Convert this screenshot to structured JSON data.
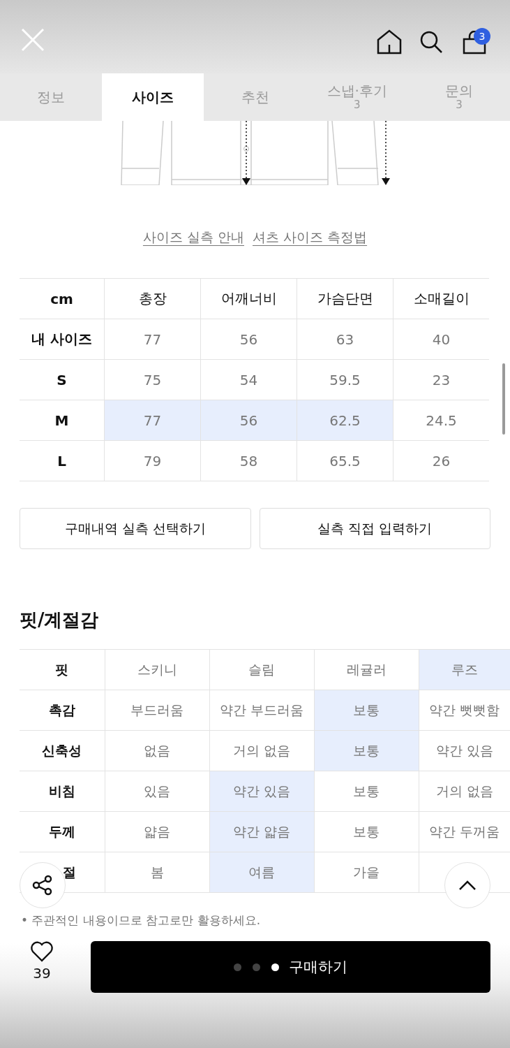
{
  "header": {
    "cart_count": "3"
  },
  "tabs": [
    {
      "label": "정보",
      "selected": false
    },
    {
      "label": "사이즈",
      "selected": true
    },
    {
      "label": "추천",
      "selected": false
    },
    {
      "label": "스냅·후기",
      "count": "3",
      "selected": false
    },
    {
      "label": "문의",
      "count": "3",
      "selected": false
    }
  ],
  "guide_links": [
    "사이즈 실측 안내",
    "셔츠 사이즈 측정법"
  ],
  "size_table": {
    "corner_label": "cm",
    "columns": [
      "총장",
      "어깨너비",
      "가슴단면",
      "소매길이"
    ],
    "rows": [
      {
        "label": "내 사이즈",
        "cells": [
          {
            "value": "77",
            "selected": false
          },
          {
            "value": "56",
            "selected": false
          },
          {
            "value": "63",
            "selected": false
          },
          {
            "value": "40",
            "selected": false
          }
        ]
      },
      {
        "label": "S",
        "cells": [
          {
            "value": "75",
            "selected": false
          },
          {
            "value": "54",
            "selected": false
          },
          {
            "value": "59.5",
            "selected": false
          },
          {
            "value": "23",
            "selected": false
          }
        ]
      },
      {
        "label": "M",
        "cells": [
          {
            "value": "77",
            "selected": true
          },
          {
            "value": "56",
            "selected": true
          },
          {
            "value": "62.5",
            "selected": true
          },
          {
            "value": "24.5",
            "selected": false
          }
        ]
      },
      {
        "label": "L",
        "cells": [
          {
            "value": "79",
            "selected": false
          },
          {
            "value": "58",
            "selected": false
          },
          {
            "value": "65.5",
            "selected": false
          },
          {
            "value": "26",
            "selected": false
          }
        ]
      }
    ]
  },
  "actions": [
    "구매내역 실측 선택하기",
    "실측 직접 입력하기"
  ],
  "fit_section": {
    "title": "핏/계절감",
    "rows": [
      {
        "label": "핏",
        "options": [
          {
            "label": "스키니",
            "selected": false
          },
          {
            "label": "슬림",
            "selected": false
          },
          {
            "label": "레귤러",
            "selected": false
          },
          {
            "label": "루즈",
            "selected": true
          }
        ]
      },
      {
        "label": "촉감",
        "options": [
          {
            "label": "부드러움",
            "selected": false
          },
          {
            "label": "약간 부드러움",
            "selected": false
          },
          {
            "label": "보통",
            "selected": true
          },
          {
            "label": "약간 뻣뻣함",
            "selected": false
          }
        ]
      },
      {
        "label": "신축성",
        "options": [
          {
            "label": "없음",
            "selected": false
          },
          {
            "label": "거의 없음",
            "selected": false
          },
          {
            "label": "보통",
            "selected": true
          },
          {
            "label": "약간 있음",
            "selected": false
          }
        ]
      },
      {
        "label": "비침",
        "options": [
          {
            "label": "있음",
            "selected": false
          },
          {
            "label": "약간 있음",
            "selected": true
          },
          {
            "label": "보통",
            "selected": false
          },
          {
            "label": "거의 없음",
            "selected": false
          }
        ]
      },
      {
        "label": "두께",
        "options": [
          {
            "label": "얇음",
            "selected": false
          },
          {
            "label": "약간 얇음",
            "selected": true
          },
          {
            "label": "보통",
            "selected": false
          },
          {
            "label": "약간 두꺼움",
            "selected": false
          }
        ]
      },
      {
        "label": "절",
        "options": [
          {
            "label": "봄",
            "selected": false
          },
          {
            "label": "여름",
            "selected": true
          },
          {
            "label": "가을",
            "selected": false
          }
        ]
      }
    ],
    "note": "• 주관적인 내용이므로 참고로만 활용하세요."
  },
  "bottom_bar": {
    "like_count": "39",
    "buy_label": "구매하기",
    "page_dots": [
      {
        "selected": false
      },
      {
        "selected": false
      },
      {
        "selected": true
      }
    ]
  }
}
